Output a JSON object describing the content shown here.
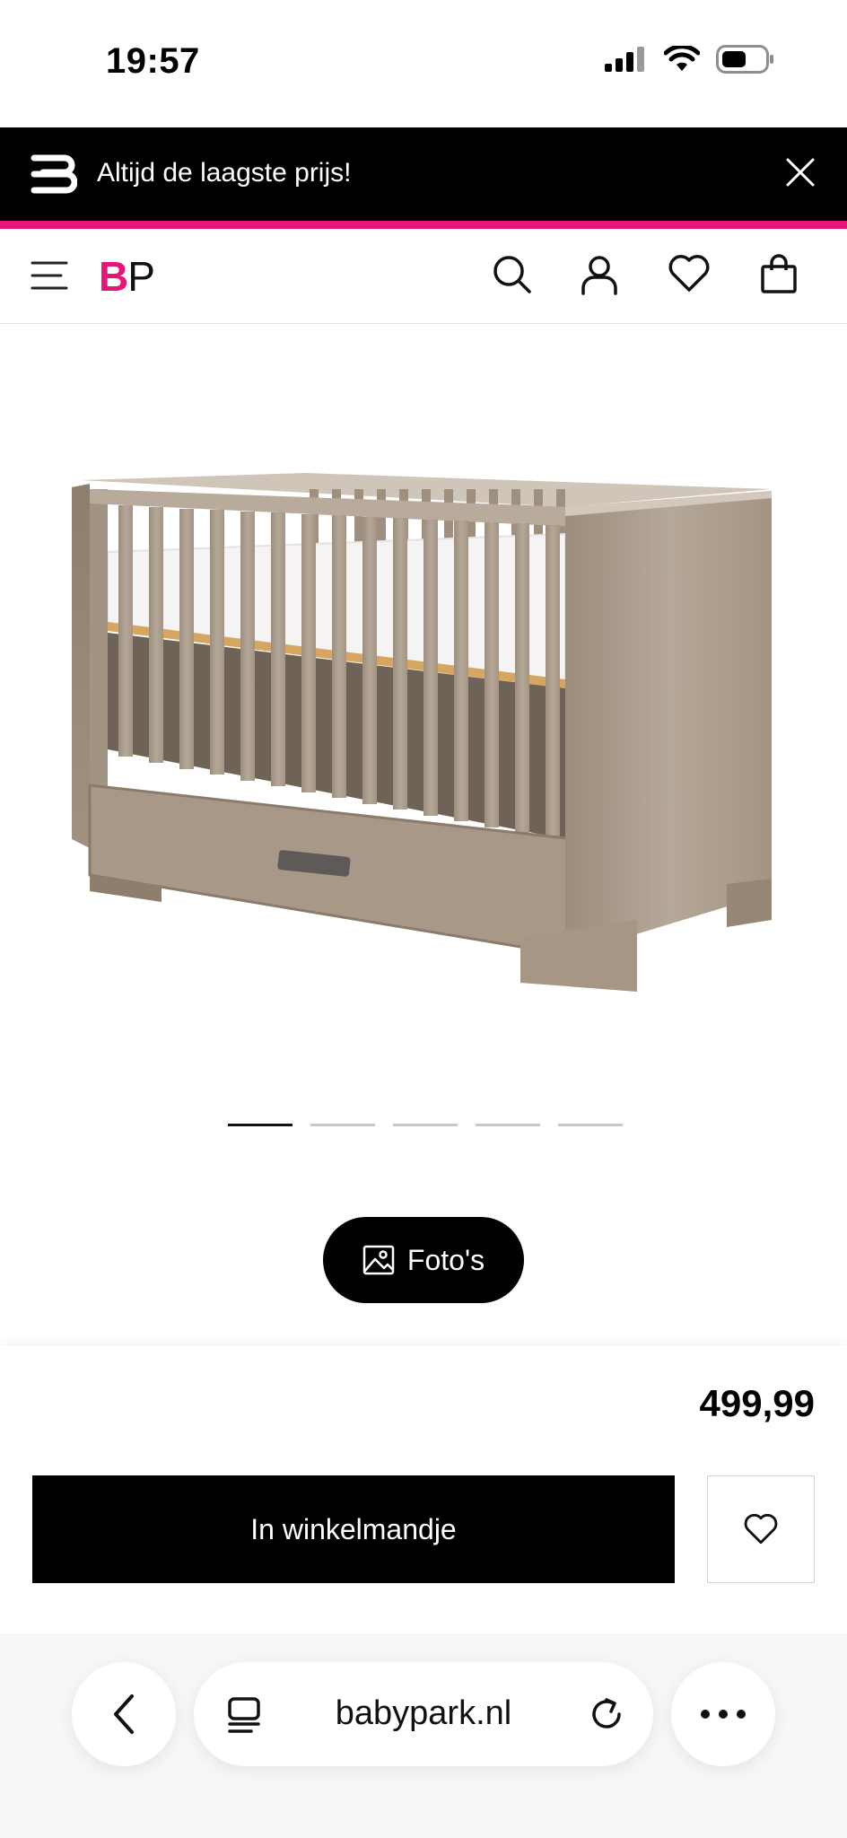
{
  "status_bar": {
    "time": "19:57",
    "icons": [
      "signal-icon",
      "wifi-icon",
      "battery-icon"
    ]
  },
  "promo": {
    "text": "Altijd de laagste prijs!",
    "accent_color": "#e6157a",
    "icons": [
      "babypark-b-logo-icon",
      "close-icon"
    ]
  },
  "header": {
    "brand_b": "B",
    "brand_p": "P",
    "brand_color": "#e6157a",
    "icons": [
      "menu-icon",
      "search-icon",
      "account-icon",
      "wishlist-heart-icon",
      "shopping-bag-icon"
    ]
  },
  "product": {
    "image_icon": "baby-crib-image",
    "carousel": {
      "count": 5,
      "active_index": 0
    },
    "photos_label": "Foto's",
    "price": "499,99",
    "add_to_cart_label": "In winkelmandje",
    "wishlist_icon": "heart-outline-icon"
  },
  "browser": {
    "url": "babypark.nl",
    "icons": [
      "back-chevron-icon",
      "reader-mode-icon",
      "reload-icon",
      "more-dots-icon"
    ]
  }
}
